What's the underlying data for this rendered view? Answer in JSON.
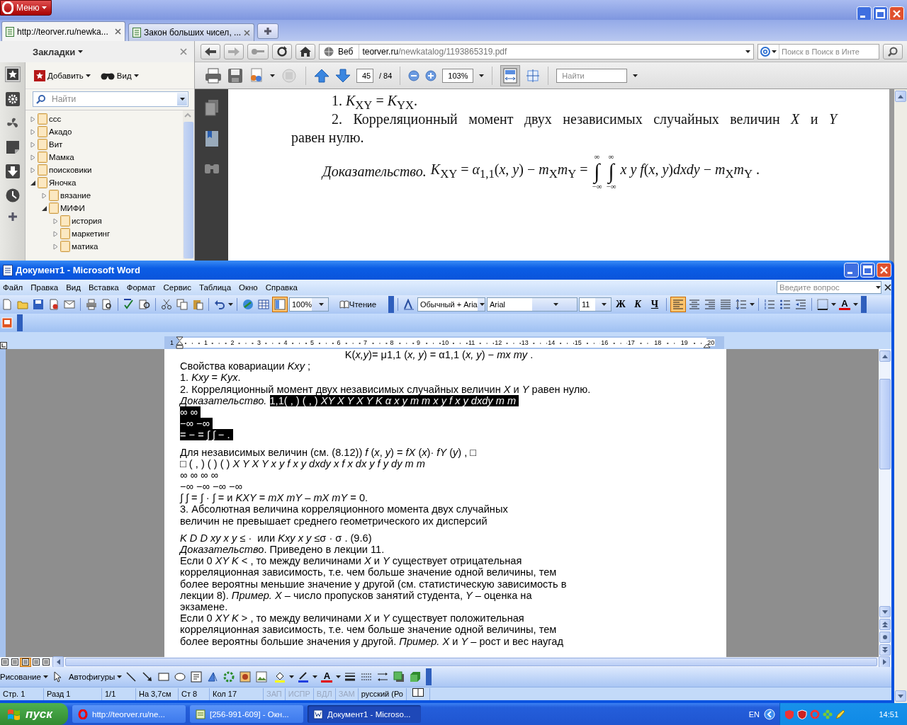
{
  "browser": {
    "menu_button": "Меню",
    "tabs": [
      {
        "label": "http://teorver.ru/newka...",
        "selected": true
      },
      {
        "label": "Закон больших чисел, ...",
        "selected": false
      }
    ],
    "sidebar": {
      "title": "Закладки",
      "add_button": "Добавить",
      "view_button": "Вид",
      "search_placeholder": "Найти",
      "bookmarks": [
        {
          "label": "ccc",
          "expanded": false
        },
        {
          "label": "Акадо",
          "expanded": false
        },
        {
          "label": "Вит",
          "expanded": false
        },
        {
          "label": "Мамка",
          "expanded": false
        },
        {
          "label": "поисковики",
          "expanded": false
        },
        {
          "label": "Яночка",
          "expanded": true,
          "children": [
            {
              "label": "вязание",
              "expanded": false
            },
            {
              "label": "МИФИ",
              "expanded": true,
              "children": [
                {
                  "label": "история",
                  "expanded": false
                },
                {
                  "label": "маркетинг",
                  "expanded": false
                },
                {
                  "label": "матика",
                  "expanded": false
                }
              ]
            }
          ]
        }
      ]
    },
    "address_bar": {
      "scope": "Веб",
      "host": "teorver.ru",
      "path": "/newkatalog/1193865319.pdf"
    },
    "search_placeholder": "Поиск в Поиск в Инте",
    "pdf_toolbar": {
      "page": "45",
      "page_total": "/ 84",
      "zoom": "103%",
      "find_placeholder": "Найти"
    },
    "pdf_page": {
      "lines": [
        {
          "text": "1. *K*$_{XY}$ = *K*$_{YX}$.",
          "indent": true
        },
        {
          "text": "2. Корреляционный момент двух независимых случайных величин *X* и *Y*",
          "indent": true
        },
        {
          "text": "равен нулю.",
          "indent": false
        }
      ],
      "formula": {
        "label": "Доказательство.",
        "lead": "*K*$_{XY}$ = *α*$_{1,1}$(*x*, *y*) − *m*$_{X}$*m*$_{Y}$ =",
        "integrals": [
          {
            "upper": "∞",
            "sign": "∫",
            "lower": "−∞"
          },
          {
            "upper": "∞",
            "sign": "∫",
            "lower": "−∞"
          }
        ],
        "tail": "*x  y  f*(*x*, *y*)*dxdy* − *m*$_{X}$*m*$_{Y}$ ."
      }
    }
  },
  "word": {
    "title": "Документ1 - Microsoft Word",
    "menu": [
      "Файл",
      "Правка",
      "Вид",
      "Вставка",
      "Формат",
      "Сервис",
      "Таблица",
      "Окно",
      "Справка"
    ],
    "help_placeholder": "Введите вопрос",
    "zoom": "100%",
    "reading_button": "Чтение",
    "style": "Обычный + Aria",
    "font": "Arial",
    "size": "11",
    "format_buttons": [
      "Ж",
      "К",
      "Ч"
    ],
    "align_buttons": [
      {
        "selected": true
      },
      {
        "selected": false
      },
      {
        "selected": false
      },
      {
        "selected": false
      }
    ],
    "font_color_button": "A",
    "ruler": [
      "1",
      "1",
      "2",
      "3",
      "4",
      "5",
      "6",
      "7",
      "8",
      "9",
      "10",
      "11",
      "12",
      "13",
      "14",
      "15",
      "16",
      "17",
      "18",
      "19",
      "20"
    ],
    "document": [
      {
        "kind": "centered",
        "parts": [
          {
            "text": "K(*x,y*)= μ1,1 (*x, y*) = α1,1 (*x, y*) − *mx my* .",
            "selected": false
          }
        ]
      },
      {
        "kind": "text",
        "parts": [
          {
            "text": "Свойства ковариации *Kxy* ;",
            "selected": false
          }
        ]
      },
      {
        "kind": "text",
        "parts": [
          {
            "text": "1. *Kxy* = *Kyx*.",
            "selected": false
          }
        ]
      },
      {
        "kind": "text",
        "parts": [
          {
            "text": "2. Корреляционный момент двух независимых случайных величин *X* и *Y* равен нулю.",
            "selected": false
          }
        ]
      },
      {
        "kind": "text",
        "parts": [
          {
            "text": "*Доказательство.* ",
            "selected": false
          },
          {
            "text": "1,1( , ) ( , ) *XY X Y X Y K α x y m m x y f x y dxdy m m* ",
            "selected": true
          }
        ]
      },
      {
        "kind": "text",
        "parts": [
          {
            "text": "∞ ∞ ",
            "selected": true
          }
        ]
      },
      {
        "kind": "text",
        "parts": [
          {
            "text": "−∞ −∞ ",
            "selected": true
          }
        ]
      },
      {
        "kind": "text",
        "parts": [
          {
            "text": "= − = ∫ ∫ − . ",
            "selected": true
          }
        ]
      },
      {
        "kind": "spaced",
        "parts": [
          {
            "text": "Для независимых величин (см. (8.12)) *f* (*x*, *y*) = *fX* (*x*)· *fY* (*y*) , □",
            "selected": false
          }
        ]
      },
      {
        "kind": "text",
        "parts": [
          {
            "text": "□ ( , ) ( ) ( ) *X Y X Y x y f x y dxdy x f x dx y f y dy m m*",
            "selected": false
          }
        ]
      },
      {
        "kind": "text",
        "parts": [
          {
            "text": "∞ ∞ ∞ ∞",
            "selected": false
          }
        ]
      },
      {
        "kind": "text",
        "parts": [
          {
            "text": "−∞ −∞ −∞ −∞",
            "selected": false
          }
        ]
      },
      {
        "kind": "text",
        "parts": [
          {
            "text": "∫ ∫ = ∫ · ∫ = и *KXY* = *mX mY* – *mX mY* = 0.",
            "selected": false
          }
        ]
      },
      {
        "kind": "text",
        "parts": [
          {
            "text": "3. Абсолютная величина корреляционного момента двух случайных",
            "selected": false
          }
        ]
      },
      {
        "kind": "text",
        "parts": [
          {
            "text": "величин не превышает среднего геометрического их дисперсий",
            "selected": false
          }
        ]
      },
      {
        "kind": "spaced",
        "parts": [
          {
            "text": "*K D D xy x y* ≤ ·  или *Kxy x y* ≤σ · σ . (9.6)",
            "selected": false
          }
        ]
      },
      {
        "kind": "text",
        "parts": [
          {
            "text": "*Доказательство*. Приведено в лекции 11.",
            "selected": false
          }
        ]
      },
      {
        "kind": "text",
        "parts": [
          {
            "text": "Если 0 *XY K* < , то между величинами *X* и *Y* существует отрицательная",
            "selected": false
          }
        ]
      },
      {
        "kind": "text",
        "parts": [
          {
            "text": "корреляционная зависимость, т.е. чем больше значение одной величины, тем",
            "selected": false
          }
        ]
      },
      {
        "kind": "text",
        "parts": [
          {
            "text": "более вероятны меньшие значение у другой (см. статистическую зависимость в",
            "selected": false
          }
        ]
      },
      {
        "kind": "text",
        "parts": [
          {
            "text": "лекции 8). *Пример.* *X* – число пропусков занятий студента, *Y* – оценка на",
            "selected": false
          }
        ]
      },
      {
        "kind": "text",
        "parts": [
          {
            "text": "экзамене.",
            "selected": false
          }
        ]
      },
      {
        "kind": "text",
        "parts": [
          {
            "text": "Если 0 *XY K* > , то между величинами *X* и *Y* существует положительная",
            "selected": false
          }
        ]
      },
      {
        "kind": "text",
        "parts": [
          {
            "text": "корреляционная зависимость, т.е. чем больше значение одной величины, тем",
            "selected": false
          }
        ]
      },
      {
        "kind": "text",
        "parts": [
          {
            "text": "более вероятны большие значения у другой. *Пример.* *X* и *Y* – рост и вес наугад",
            "selected": false
          }
        ]
      }
    ],
    "drawing_toolbar": {
      "draw_menu": "Рисование",
      "autoshapes_menu": "Автофигуры",
      "font_color_button": "A"
    },
    "status_bar": {
      "fields": [
        "Стр. 1",
        "Разд 1",
        "1/1",
        "На 3,7см",
        "Ст 8",
        "Кол 17"
      ],
      "modes": [
        {
          "label": "ЗАП",
          "on": false
        },
        {
          "label": "ИСПР",
          "on": false
        },
        {
          "label": "ВДЛ",
          "on": false
        },
        {
          "label": "ЗАМ",
          "on": false
        }
      ],
      "language": "русский (Ро"
    }
  },
  "taskbar": {
    "start": "пуск",
    "tasks": [
      {
        "label": "http://teorver.ru/ne...",
        "selected": false
      },
      {
        "label": "[256-991-609] - Окн...",
        "selected": false
      },
      {
        "label": "Документ1 - Microso...",
        "selected": true
      }
    ],
    "language": "EN",
    "clock": "14:51"
  }
}
